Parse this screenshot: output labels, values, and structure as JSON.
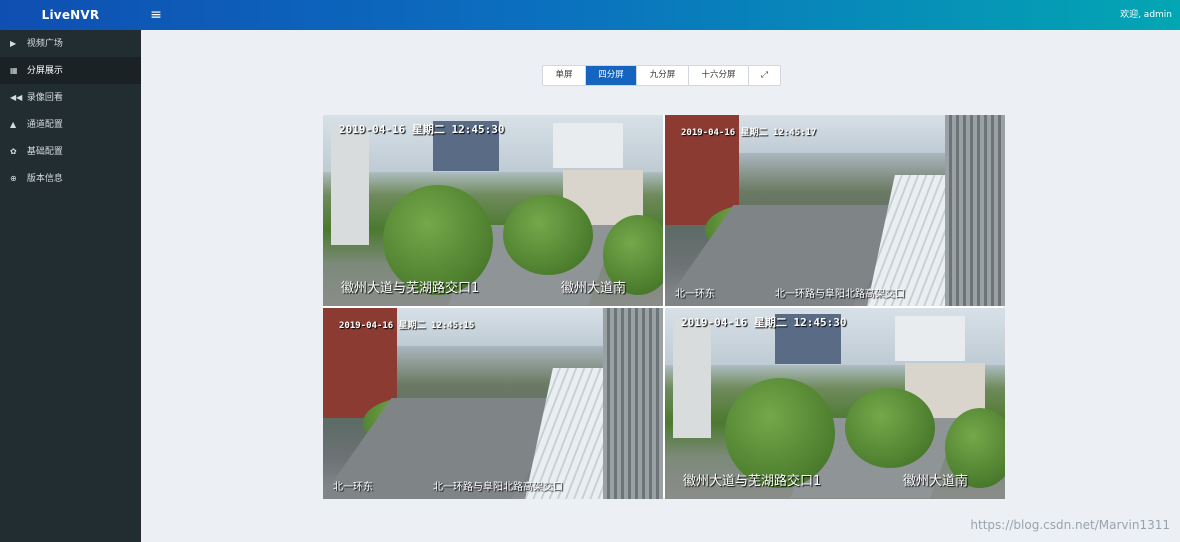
{
  "header": {
    "logo": "LiveNVR",
    "menu_icon": "hamburger-icon",
    "welcome": "欢迎, admin"
  },
  "sidebar": {
    "items": [
      {
        "label": "视频广场",
        "icon": "play-icon",
        "glyph": "▶"
      },
      {
        "label": "分屏展示",
        "icon": "grid-icon",
        "glyph": "▦"
      },
      {
        "label": "录像回看",
        "icon": "rewind-icon",
        "glyph": "◀◀"
      },
      {
        "label": "通道配置",
        "icon": "camera-icon",
        "glyph": "▲"
      },
      {
        "label": "基础配置",
        "icon": "gear-icon",
        "glyph": "✿"
      },
      {
        "label": "版本信息",
        "icon": "info-icon",
        "glyph": "⊕"
      }
    ]
  },
  "split_buttons": {
    "single": "单屏",
    "four": "四分屏",
    "nine": "九分屏",
    "sixteen": "十六分屏",
    "fullscreen_glyph": "⤢"
  },
  "tiles": [
    {
      "time": "2019-04-16 星期二 12:45:30",
      "loc_left": "徽州大道与芜湖路交口1",
      "loc_right": "徽州大道南"
    },
    {
      "time": "2019-04-16 星期二 12:45:17",
      "loc_left": "北一环东",
      "loc_right": "北一环路与阜阳北路高架交口"
    },
    {
      "time": "2019-04-16 星期二 12:45:15",
      "loc_left": "北一环东",
      "loc_right": "北一环路与阜阳北路高架交口"
    },
    {
      "time": "2019-04-16 星期二 12:45:30",
      "loc_left": "徽州大道与芜湖路交口1",
      "loc_right": "徽州大道南"
    }
  ],
  "watermark": "https://blog.csdn.net/Marvin1311"
}
